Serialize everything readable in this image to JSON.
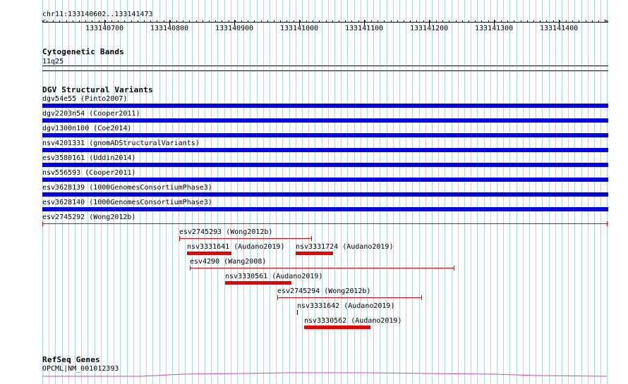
{
  "location": "chr11:133140602..133141473",
  "ruler": {
    "ticks": [
      "133140700",
      "133140800",
      "133140900",
      "133141000",
      "133141100",
      "133141200",
      "133141300",
      "133141400"
    ]
  },
  "tracks": {
    "cytoband": {
      "title": "Cytogenetic Bands",
      "band": "11q25"
    },
    "dgv": {
      "title": "DGV Structural Variants",
      "full_width_features": [
        {
          "label": "dgv54e55 (Pinto2007)",
          "color": "#0000ee"
        },
        {
          "label": "dgv2203n54 (Cooper2011)",
          "color": "#0000ee"
        },
        {
          "label": "dgv1300n100 (Coe2014)",
          "color": "#0000ee"
        },
        {
          "label": "nsv4201331 (gnomADStructuralVariants)",
          "color": "#0000ee"
        },
        {
          "label": "esv3580161 (Uddin2014)",
          "color": "#0000ee"
        },
        {
          "label": "nsv556593 (Cooper2011)",
          "color": "#0000ee"
        },
        {
          "label": "esv3628139 (1000GenomesConsortiumPhase3)",
          "color": "#0000ee"
        },
        {
          "label": "esv3628140 (1000GenomesConsortiumPhase3)",
          "color": "#0000ee"
        }
      ],
      "spanning_feature": {
        "label": "esv2745292 (Wong2012b)",
        "color": "#ee0000"
      },
      "red_features": [
        {
          "label": "esv2745293 (Wong2012b)",
          "style": "thin"
        },
        {
          "label": "nsv3331641 (Audano2019)",
          "style": "thick"
        },
        {
          "label": "nsv3331724 (Audano2019)",
          "style": "thick"
        },
        {
          "label": "esv4290 (Wang2008)",
          "style": "thin"
        },
        {
          "label": "nsv3330561 (Audano2019)",
          "style": "thick"
        },
        {
          "label": "esv2745294 (Wong2012b)",
          "style": "thin"
        },
        {
          "label": "nsv3331642 (Audano2019)",
          "style": "point"
        },
        {
          "label": "nsv3330562 (Audano2019)",
          "style": "thick"
        }
      ]
    },
    "refseq": {
      "title": "RefSeq Genes",
      "gene": "OPCML|NM_001012393",
      "color": "#cc44cc"
    }
  },
  "colors": {
    "grid": "#a8d8e0",
    "variant_blue": "#0000ee",
    "variant_red": "#ee0000",
    "gene": "#cc44cc"
  }
}
